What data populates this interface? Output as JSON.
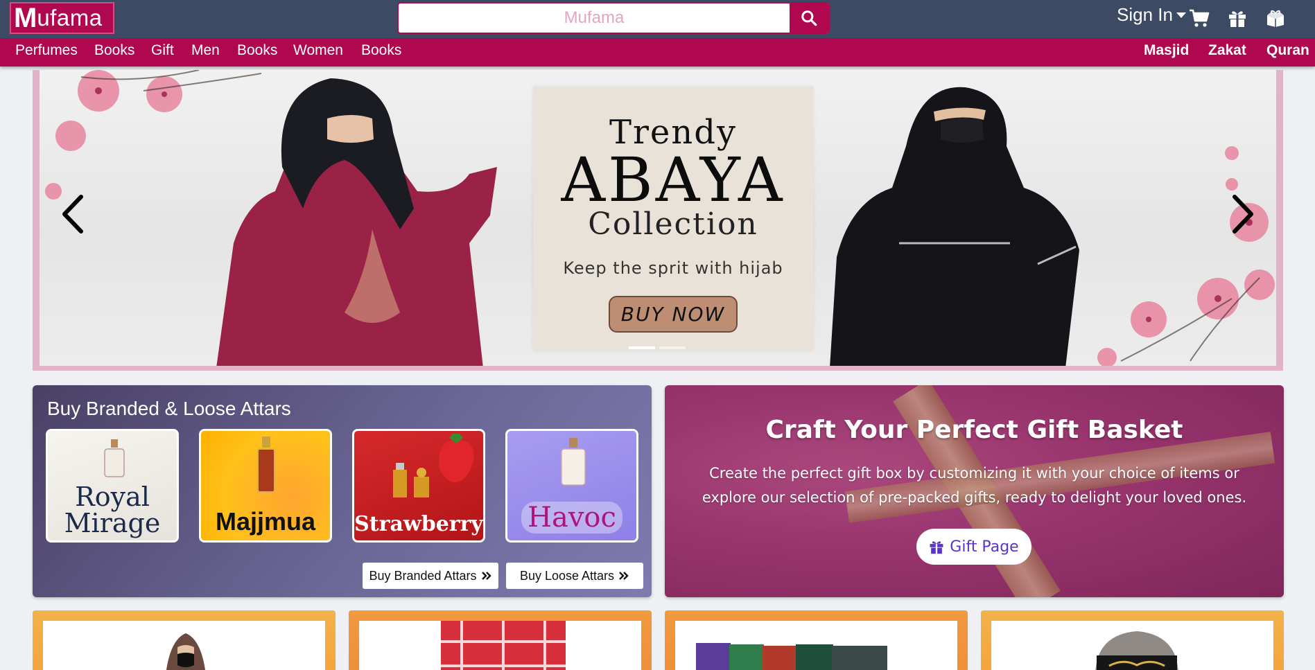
{
  "header": {
    "logo_initial": "M",
    "logo_rest": "ufama",
    "search": {
      "placeholder": "Mufama",
      "value": ""
    },
    "sign_in_label": "Sign In",
    "icons": [
      "search-icon",
      "caret-down-icon",
      "cart-icon",
      "gift-icon",
      "gift-box-icon"
    ]
  },
  "nav": {
    "left": [
      "Perfumes",
      "Books",
      "Gift",
      "Men",
      "Books",
      "Women",
      "Books"
    ],
    "right": [
      "Masjid",
      "Zakat",
      "Quran"
    ]
  },
  "hero": {
    "line1": "Trendy",
    "line2": "ABAYA",
    "line3": "Collection",
    "tagline": "Keep the sprit with hijab",
    "cta": "BUY NOW",
    "slide_count": 2,
    "active_slide": 1
  },
  "attars": {
    "title": "Buy Branded & Loose Attars",
    "cards": [
      {
        "name_line1": "Royal",
        "name_line2": "Mirage"
      },
      {
        "name_line1": "Majjmua",
        "name_line2": ""
      },
      {
        "name_line1": "Strawberry",
        "name_line2": ""
      },
      {
        "name_line1": "Havoc",
        "name_line2": ""
      }
    ],
    "branded_button": "Buy Branded Attars",
    "loose_button": "Buy Loose Attars"
  },
  "gift": {
    "title": "Craft Your Perfect Gift Basket",
    "line1": "Create the perfect gift box by customizing it with your choice of items or",
    "line2": "explore our selection of pre-packed gifts, ready to delight your loved ones.",
    "button": "Gift Page"
  },
  "colors": {
    "brand": "#b0084f",
    "header_bg": "#3c4a63",
    "attars_bg": "#5d5787",
    "gift_button_text": "#5b33c7",
    "tile_border": "#f5a43c"
  }
}
